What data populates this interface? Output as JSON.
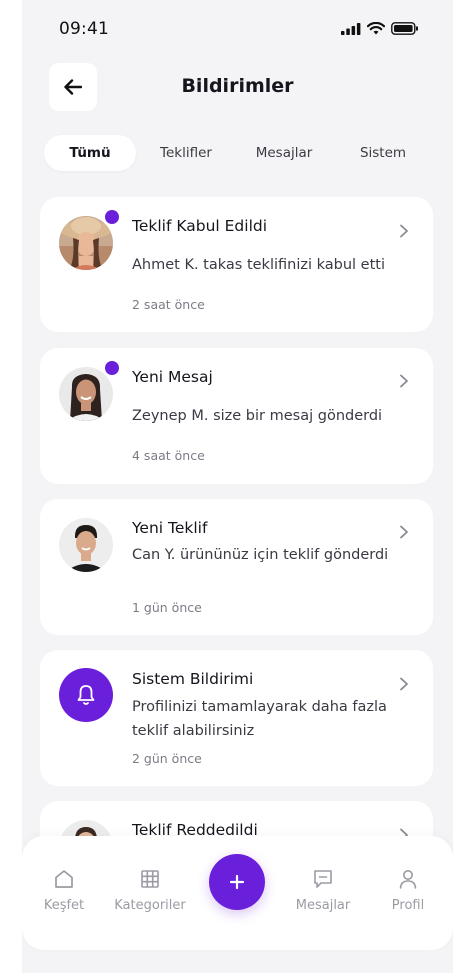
{
  "status": {
    "time": "09:41"
  },
  "header": {
    "title": "Bildirimler"
  },
  "tabs": [
    {
      "label": "Tümü",
      "active": true
    },
    {
      "label": "Teklifler",
      "active": false
    },
    {
      "label": "Mesajlar",
      "active": false
    },
    {
      "label": "Sistem",
      "active": false
    }
  ],
  "notifications": [
    {
      "title": "Teklif Kabul Edildi",
      "message": "Ahmet K. takas teklifinizi kabul etti",
      "time": "2 saat önce",
      "unread": true,
      "avatar": "user-photo"
    },
    {
      "title": "Yeni Mesaj",
      "message": "Zeynep M. size bir mesaj gönderdi",
      "time": "4 saat önce",
      "unread": true,
      "avatar": "user-photo"
    },
    {
      "title": "Yeni Teklif",
      "message": "Can Y. ürününüz için teklif gönderdi",
      "time": "1 gün önce",
      "unread": false,
      "avatar": "user-photo"
    },
    {
      "title": "Sistem Bildirimi",
      "message": "Profilinizi tamamlayarak daha fazla teklif alabilirsiniz",
      "time": "2 gün önce",
      "unread": false,
      "avatar": "bell-icon"
    },
    {
      "title": "Teklif Reddedildi",
      "message": "",
      "time": "",
      "unread": false,
      "avatar": "user-photo"
    }
  ],
  "bottom_nav": {
    "items": [
      {
        "label": "Keşfet",
        "icon": "home-icon"
      },
      {
        "label": "Kategoriler",
        "icon": "grid-icon"
      },
      {
        "label": "Mesajlar",
        "icon": "message-icon"
      },
      {
        "label": "Profil",
        "icon": "user-icon"
      }
    ],
    "fab_icon": "plus-icon"
  },
  "colors": {
    "accent": "#6a1fdb",
    "background": "#f4f4f6",
    "card": "#ffffff",
    "nav_inactive": "#9b9ba4"
  }
}
